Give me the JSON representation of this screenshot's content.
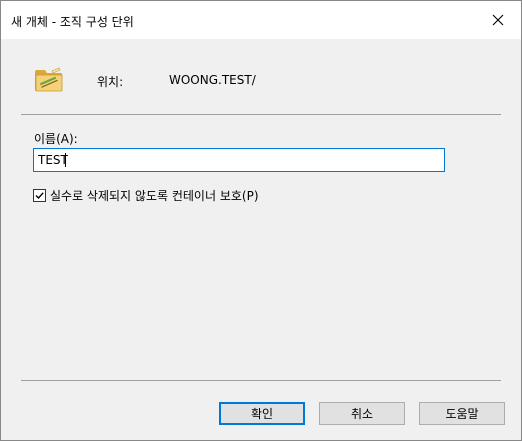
{
  "window": {
    "title": "새 개체 - 조직 구성 단위"
  },
  "location": {
    "label": "위치:",
    "value": "WOONG.TEST/",
    "icon": "folder-icon"
  },
  "name_field": {
    "label": "이름(A):",
    "value": "TEST"
  },
  "protect": {
    "label": "실수로 삭제되지 않도록 컨테이너 보호(P)",
    "checked": true
  },
  "buttons": {
    "ok": "확인",
    "cancel": "취소",
    "help": "도움말"
  },
  "colors": {
    "accent": "#0078d7",
    "dialog_background": "#f0f0f0",
    "titlebar_background": "#ffffff"
  }
}
